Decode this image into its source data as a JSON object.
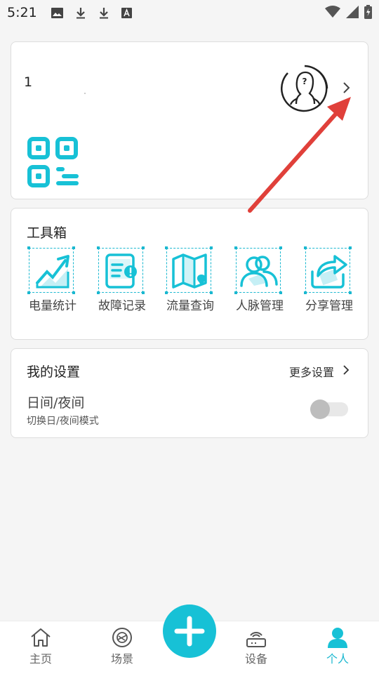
{
  "status_bar": {
    "time": "5:21",
    "icons": [
      "image-icon",
      "download-icon",
      "download-icon",
      "font-icon"
    ],
    "right_icons": [
      "wifi-icon",
      "signal-icon",
      "battery-icon"
    ]
  },
  "profile": {
    "name": "1",
    "avatar_icon": "avatar-placeholder-icon",
    "chevron_icon": "chevron-right-icon",
    "qr_icon": "qr-code-icon"
  },
  "tools": {
    "title": "工具箱",
    "items": [
      {
        "label": "电量统计",
        "icon": "power-stats-icon"
      },
      {
        "label": "故障记录",
        "icon": "fault-record-icon"
      },
      {
        "label": "流量查询",
        "icon": "traffic-query-icon"
      },
      {
        "label": "人脉管理",
        "icon": "contacts-icon"
      },
      {
        "label": "分享管理",
        "icon": "share-icon"
      }
    ]
  },
  "settings": {
    "title": "我的设置",
    "more_label": "更多设置",
    "day_night_label": "日间/夜间",
    "day_night_sub": "切换日/夜间模式",
    "day_night_enabled": false
  },
  "nav": {
    "items": [
      {
        "label": "主页",
        "icon": "home-icon",
        "active": false
      },
      {
        "label": "场景",
        "icon": "scene-icon",
        "active": false
      },
      {
        "label": "设备",
        "icon": "device-icon",
        "active": false
      },
      {
        "label": "个人",
        "icon": "person-icon",
        "active": true
      }
    ],
    "add_icon": "plus-icon"
  },
  "colors": {
    "accent": "#17c1d6",
    "annotation_arrow": "#e0403a"
  }
}
